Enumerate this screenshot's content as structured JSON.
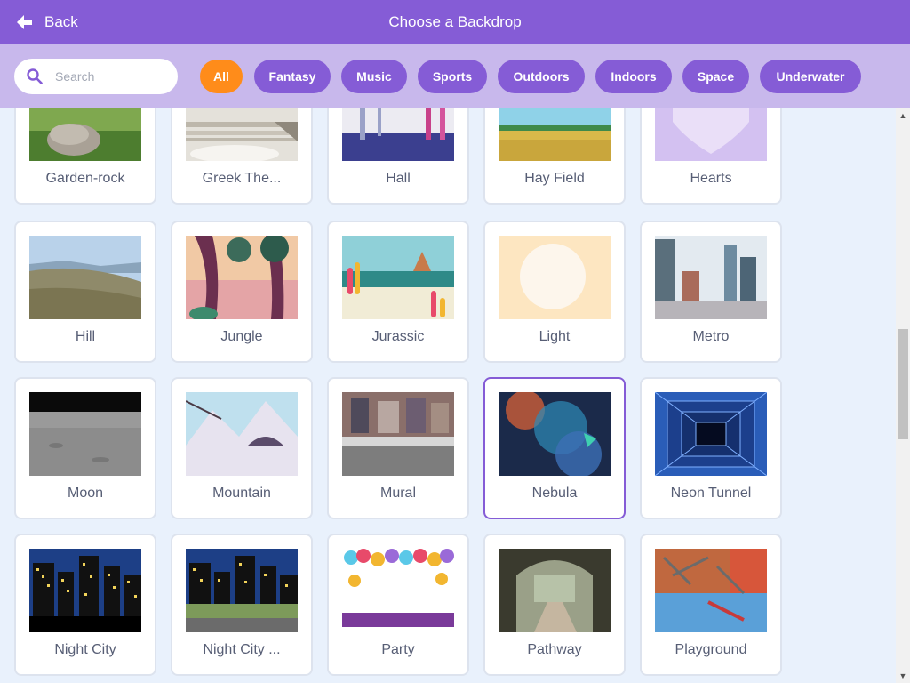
{
  "header": {
    "back_label": "Back",
    "title": "Choose a Backdrop",
    "back_icon": "arrow-left-icon"
  },
  "search": {
    "placeholder": "Search",
    "value": "",
    "icon": "search-icon"
  },
  "filters": [
    {
      "label": "All",
      "active": true
    },
    {
      "label": "Fantasy",
      "active": false
    },
    {
      "label": "Music",
      "active": false
    },
    {
      "label": "Sports",
      "active": false
    },
    {
      "label": "Outdoors",
      "active": false
    },
    {
      "label": "Indoors",
      "active": false
    },
    {
      "label": "Space",
      "active": false
    },
    {
      "label": "Underwater",
      "active": false
    }
  ],
  "backdrops": [
    {
      "label": "Garden-rock"
    },
    {
      "label": "Greek The..."
    },
    {
      "label": "Hall"
    },
    {
      "label": "Hay Field"
    },
    {
      "label": "Hearts"
    },
    {
      "label": "Hill"
    },
    {
      "label": "Jungle"
    },
    {
      "label": "Jurassic"
    },
    {
      "label": "Light"
    },
    {
      "label": "Metro"
    },
    {
      "label": "Moon"
    },
    {
      "label": "Mountain"
    },
    {
      "label": "Mural"
    },
    {
      "label": "Nebula",
      "selected": true
    },
    {
      "label": "Neon Tunnel"
    },
    {
      "label": "Night City"
    },
    {
      "label": "Night City ..."
    },
    {
      "label": "Party"
    },
    {
      "label": "Pathway"
    },
    {
      "label": "Playground"
    }
  ],
  "colors": {
    "header": "#855cd6",
    "filterbar": "#c8b8ec",
    "active_filter": "#ff8c1a",
    "background": "#e9f1fc"
  }
}
